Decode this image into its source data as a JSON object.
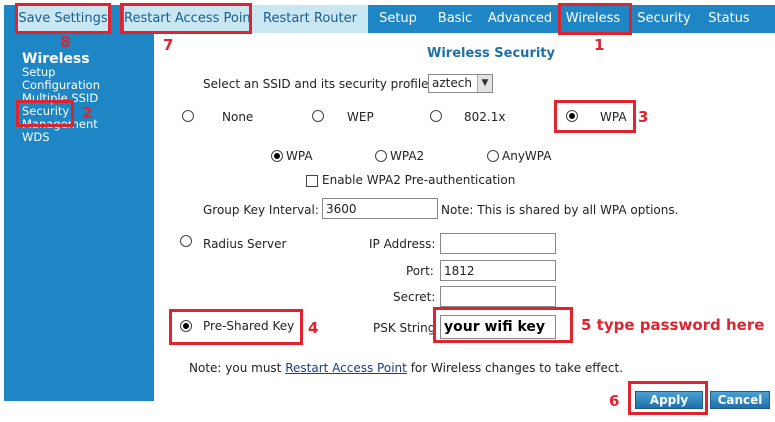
{
  "top_tabs": [
    {
      "label": "Save Settings"
    },
    {
      "label": "Restart Access Point"
    },
    {
      "label": "Restart Router"
    },
    {
      "label": "Setup"
    },
    {
      "label": "Basic"
    },
    {
      "label": "Advanced"
    },
    {
      "label": "Wireless"
    },
    {
      "label": "Security"
    },
    {
      "label": "Status"
    }
  ],
  "sidebar": {
    "title": "Wireless",
    "items": [
      "Setup",
      "Configuration",
      "Multiple SSID",
      "Security",
      "Management",
      "WDS"
    ]
  },
  "main": {
    "title": "Wireless Security",
    "ssid_label": "Select an SSID and its security profile:",
    "ssid_value": "aztech",
    "profiles": [
      "None",
      "WEP",
      "802.1x",
      "WPA"
    ],
    "wpa_modes": [
      "WPA",
      "WPA2",
      "AnyWPA"
    ],
    "preauth_label": "Enable WPA2 Pre-authentication",
    "group_key_label": "Group Key Interval:",
    "group_key_value": "3600",
    "group_key_note": "Note: This is shared by all WPA options.",
    "radius_label": "Radius Server",
    "ip_label": "IP Address:",
    "ip_value": "",
    "port_label": "Port:",
    "port_value": "1812",
    "secret_label": "Secret:",
    "secret_value": "",
    "psk_label": "Pre-Shared Key",
    "psk_string_label": "PSK String",
    "psk_value": "your wifi key",
    "note_prefix": "Note: you must",
    "note_link": "Restart Access Point",
    "note_suffix": "for Wireless changes to take effect.",
    "apply": "Apply",
    "cancel": "Cancel"
  },
  "annotations": {
    "n1": "1",
    "n2": "2",
    "n3": "3",
    "n4": "4",
    "n5": "5 type password here",
    "n6": "6",
    "n7": "7",
    "n8": "8"
  },
  "colors": {
    "accent": "#1f86c5",
    "annotation": "#e0242f",
    "title": "#1f6fa8"
  }
}
